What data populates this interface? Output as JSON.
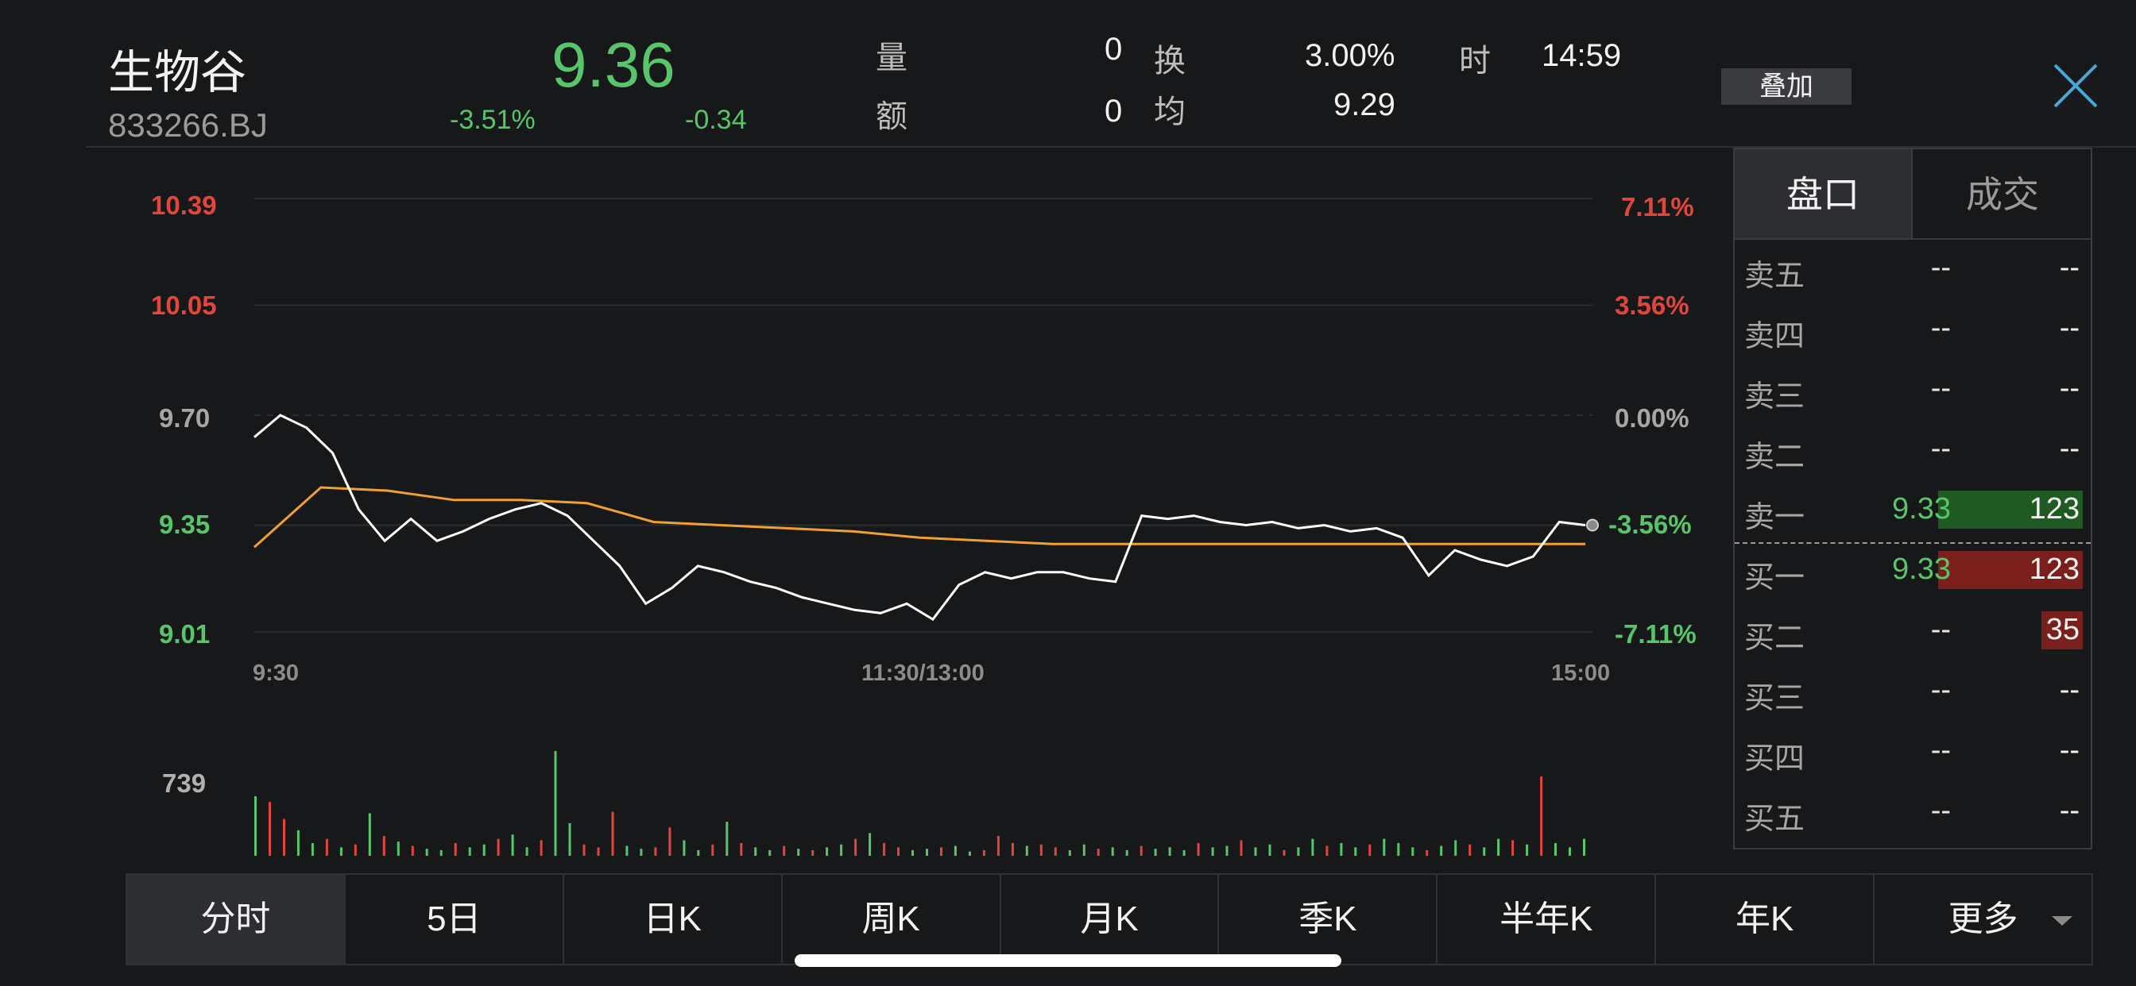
{
  "header": {
    "stock_name": "生物谷",
    "stock_code": "833266.BJ",
    "price": "9.36",
    "change_pct": "-3.51%",
    "change_amt": "-0.34",
    "volume_label": "量",
    "volume_value": "0",
    "amount_label": "额",
    "amount_value": "0",
    "turnover_label": "换",
    "turnover_value": "3.00%",
    "avg_label": "均",
    "avg_value": "9.29",
    "time_label": "时",
    "time_value": "14:59",
    "overlay_label": "叠加",
    "close_icon": "close-icon"
  },
  "chart_labels": {
    "price_ticks": [
      "10.39",
      "10.05",
      "9.70",
      "9.35",
      "9.01"
    ],
    "pct_ticks": [
      "7.11%",
      "3.56%",
      "0.00%",
      "-3.56%",
      "-7.11%"
    ],
    "time_ticks": [
      "9:30",
      "11:30/13:00",
      "15:00"
    ],
    "volume_max": "739"
  },
  "colors": {
    "up": "#e2453c",
    "down": "#58c56a",
    "price_line": "#ffffff",
    "avg_line": "#f0a030",
    "background": "#17181a"
  },
  "chart_data": {
    "type": "line",
    "x": [
      "9:30",
      "11:30/13:00",
      "15:00"
    ],
    "ylim": [
      9.01,
      10.39
    ],
    "reference_price": 9.7,
    "series": [
      {
        "values": [
          9.63,
          9.7,
          9.66,
          9.58,
          9.4,
          9.3,
          9.37,
          9.3,
          9.33,
          9.37,
          9.4,
          9.42,
          9.38,
          9.3,
          9.22,
          9.1,
          9.15,
          9.22,
          9.2,
          9.17,
          9.15,
          9.12,
          9.1,
          9.08,
          9.07,
          9.1,
          9.05,
          9.16,
          9.2,
          9.18,
          9.2,
          9.2,
          9.18,
          9.17,
          9.38,
          9.37,
          9.38,
          9.36,
          9.35,
          9.36,
          9.34,
          9.35,
          9.33,
          9.34,
          9.31,
          9.19,
          9.27,
          9.24,
          9.22,
          9.25,
          9.36,
          9.35
        ],
        "price_readings": [
          9.63,
          9.4,
          9.42,
          9.12,
          9.05,
          9.2,
          9.38,
          9.33,
          9.19,
          9.36
        ]
      },
      {
        "name": "均",
        "values": [
          9.28,
          9.47,
          9.46,
          9.43,
          9.43,
          9.42,
          9.36,
          9.35,
          9.34,
          9.33,
          9.31,
          9.3,
          9.29,
          9.29,
          9.29,
          9.29,
          9.29,
          9.29,
          9.29,
          9.29,
          9.29
        ]
      }
    ],
    "volume": {
      "ymax": 739,
      "values": [
        420,
        380,
        260,
        180,
        90,
        120,
        60,
        80,
        300,
        140,
        100,
        70,
        50,
        40,
        90,
        60,
        80,
        120,
        150,
        60,
        110,
        739,
        230,
        80,
        60,
        310,
        70,
        50,
        60,
        200,
        110,
        40,
        80,
        240,
        90,
        60,
        40,
        70,
        50,
        40,
        60,
        80,
        120,
        160,
        90,
        60,
        40,
        50,
        60,
        70,
        30,
        40,
        140,
        90,
        70,
        80,
        60,
        40,
        80,
        50,
        60,
        40,
        70,
        50,
        60,
        40,
        90,
        60,
        70,
        110,
        60,
        80,
        40,
        60,
        120,
        70,
        90,
        60,
        80,
        120,
        90,
        60,
        40,
        70,
        110,
        80,
        60,
        120,
        110,
        80,
        560,
        90,
        60,
        120
      ],
      "up_flags": [
        0,
        1,
        1,
        0,
        0,
        1,
        0,
        1,
        0,
        1,
        0,
        1,
        0,
        0,
        1,
        0,
        0,
        1,
        0,
        0,
        1,
        0,
        0,
        1,
        1,
        1,
        0,
        0,
        1,
        1,
        0,
        0,
        1,
        0,
        1,
        0,
        0,
        1,
        0,
        1,
        0,
        0,
        1,
        0,
        1,
        1,
        0,
        0,
        1,
        0,
        0,
        1,
        1,
        1,
        0,
        1,
        1,
        0,
        0,
        1,
        0,
        0,
        1,
        0,
        0,
        0,
        1,
        0,
        0,
        1,
        0,
        0,
        1,
        0,
        0,
        1,
        0,
        0,
        1,
        0,
        0,
        0,
        1,
        0,
        0,
        1,
        0,
        0,
        1,
        0,
        1,
        0,
        0,
        0
      ]
    }
  },
  "order_book": {
    "tabs": [
      "盘口",
      "成交"
    ],
    "asks": [
      {
        "label": "卖五",
        "price": "--",
        "volume": "--"
      },
      {
        "label": "卖四",
        "price": "--",
        "volume": "--"
      },
      {
        "label": "卖三",
        "price": "--",
        "volume": "--"
      },
      {
        "label": "卖二",
        "price": "--",
        "volume": "--"
      },
      {
        "label": "卖一",
        "price": "9.33",
        "volume": "123"
      }
    ],
    "bids": [
      {
        "label": "买一",
        "price": "9.33",
        "volume": "123"
      },
      {
        "label": "买二",
        "price": "--",
        "volume": "35"
      },
      {
        "label": "买三",
        "price": "--",
        "volume": "--"
      },
      {
        "label": "买四",
        "price": "--",
        "volume": "--"
      },
      {
        "label": "买五",
        "price": "--",
        "volume": "--"
      }
    ]
  },
  "period_tabs": [
    "分时",
    "5日",
    "日K",
    "周K",
    "月K",
    "季K",
    "半年K",
    "年K",
    "更多"
  ]
}
